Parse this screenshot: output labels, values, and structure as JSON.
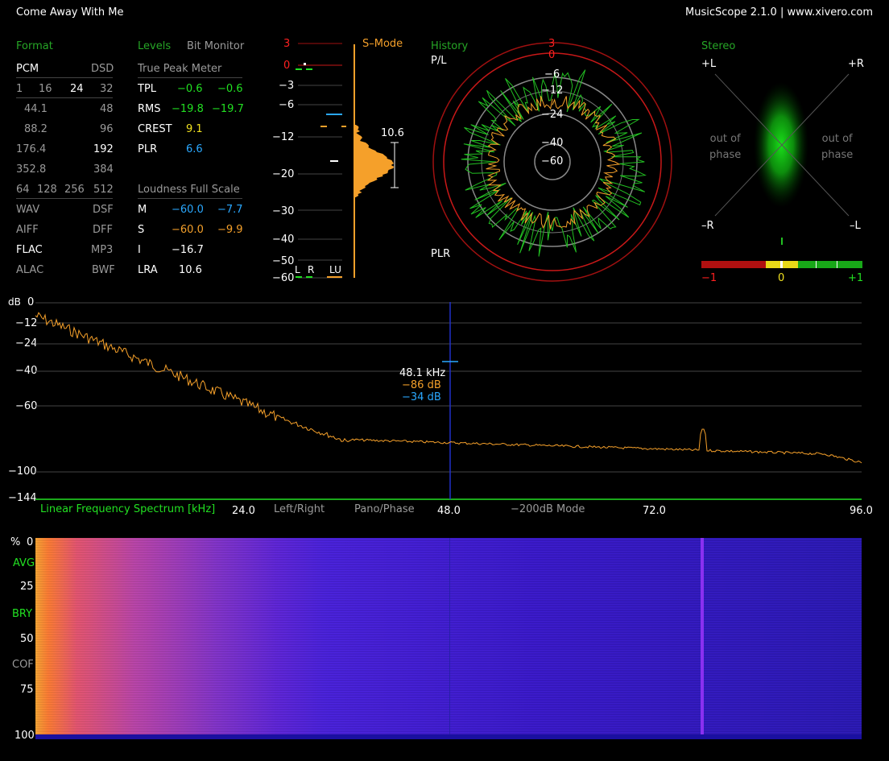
{
  "header": {
    "track_title": "Come Away With Me",
    "app_info": "MusicScope 2.1.0 | www.xivero.com"
  },
  "format": {
    "title": "Format",
    "pcm": "PCM",
    "dsd": "DSD",
    "bits": [
      "1",
      "16",
      "24",
      "32"
    ],
    "rates": [
      [
        "44.1",
        "48"
      ],
      [
        "88.2",
        "96"
      ],
      [
        "176.4",
        "192"
      ],
      [
        "352.8",
        "384"
      ]
    ],
    "dsd_rates": [
      "64",
      "128",
      "256",
      "512"
    ],
    "files": [
      [
        "WAV",
        "DSF"
      ],
      [
        "AIFF",
        "DFF"
      ],
      [
        "FLAC",
        "MP3"
      ],
      [
        "ALAC",
        "BWF"
      ]
    ]
  },
  "levels": {
    "title": "Levels",
    "bit_monitor": "Bit Monitor",
    "tpm_title": "True Peak Meter",
    "rows": [
      {
        "label": "TPL",
        "l": "−0.6",
        "r": "−0.6"
      },
      {
        "label": "RMS",
        "l": "−19.8",
        "r": "−19.7"
      },
      {
        "label": "CREST",
        "l": "9.1"
      },
      {
        "label": "PLR",
        "l": "6.6"
      }
    ],
    "lfs_title": "Loudness Full Scale",
    "loud": [
      {
        "label": "M",
        "a": "−60.0",
        "b": "−7.7"
      },
      {
        "label": "S",
        "a": "−60.0",
        "b": "−9.9"
      },
      {
        "label": "I",
        "a": "−16.7"
      },
      {
        "label": "LRA",
        "a": "10.6"
      }
    ]
  },
  "meter": {
    "scale": [
      "3",
      "0",
      "−3",
      "−6",
      "−12",
      "−20",
      "−30",
      "−40",
      "−50",
      "−60"
    ],
    "mode": "S–Mode",
    "lra_value": "10.6",
    "foot": [
      "L",
      "R",
      "LU"
    ]
  },
  "history": {
    "title": "History",
    "pl_label": "P/L",
    "plr_label": "PLR",
    "ring_labels": [
      "3",
      "0",
      "−6",
      "−12",
      "−24",
      "−40",
      "−60"
    ]
  },
  "stereo": {
    "title": "Stereo",
    "pl": "+L",
    "pr": "+R",
    "ml": "–R",
    "mr": "–L",
    "oop1": "out of\nphase",
    "oop2": "out of\nphase",
    "corr": [
      "−1",
      "0",
      "+1"
    ]
  },
  "spectrum": {
    "db_unit": "dB",
    "y_labels": [
      "0",
      "−12",
      "−24",
      "−40",
      "−60",
      "−100",
      "−144"
    ],
    "cursor": {
      "freq": "48.1 kHz",
      "a": "−86 dB",
      "b": "−34 dB"
    },
    "mode_label": "Linear Frequency Spectrum [kHz]",
    "x_labels": [
      "24.0",
      "48.0",
      "72.0",
      "96.0"
    ],
    "buttons": [
      "Left/Right",
      "Pano/Phase",
      "−200dB Mode"
    ]
  },
  "spectrogram": {
    "y_labels": [
      "%",
      "0",
      "AVG",
      "25",
      "BRY",
      "50",
      "COF",
      "75",
      "100"
    ]
  },
  "colors": {
    "green": "#26a626",
    "accent_orange": "#f5a02a",
    "cyan": "#2aa8ff",
    "red": "#ff2020"
  }
}
